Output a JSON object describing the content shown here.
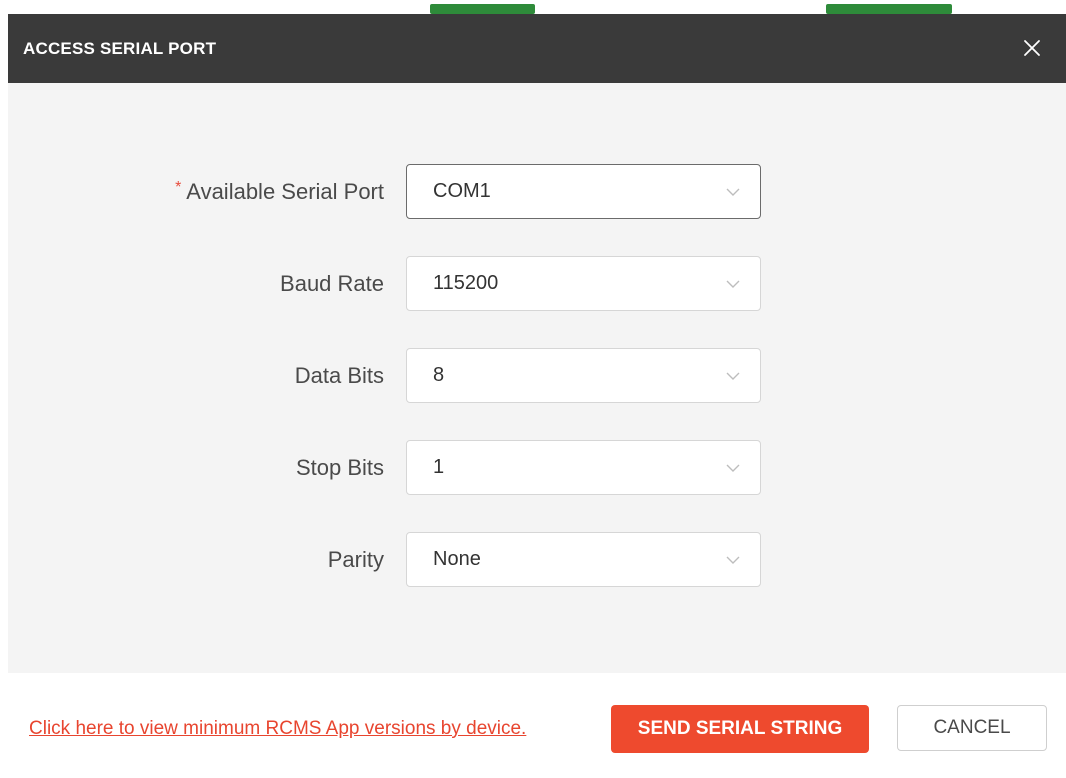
{
  "dialog": {
    "title": "ACCESS SERIAL PORT",
    "close_icon": "close-icon"
  },
  "form": {
    "serial_port": {
      "label": "Available Serial Port",
      "required_marker": "*",
      "value": "COM1"
    },
    "baud_rate": {
      "label": "Baud Rate",
      "value": "115200"
    },
    "data_bits": {
      "label": "Data Bits",
      "value": "8"
    },
    "stop_bits": {
      "label": "Stop Bits",
      "value": "1"
    },
    "parity": {
      "label": "Parity",
      "value": "None"
    },
    "dropdown_icon": "chevron-down-icon"
  },
  "footer": {
    "link_text": "Click here to view minimum RCMS App versions by device.",
    "send_label": "SEND SERIAL STRING",
    "cancel_label": "CANCEL"
  },
  "colors": {
    "header_bg": "#3a3a3a",
    "accent": "#ee4a2e",
    "body_bg": "#f4f4f4"
  }
}
